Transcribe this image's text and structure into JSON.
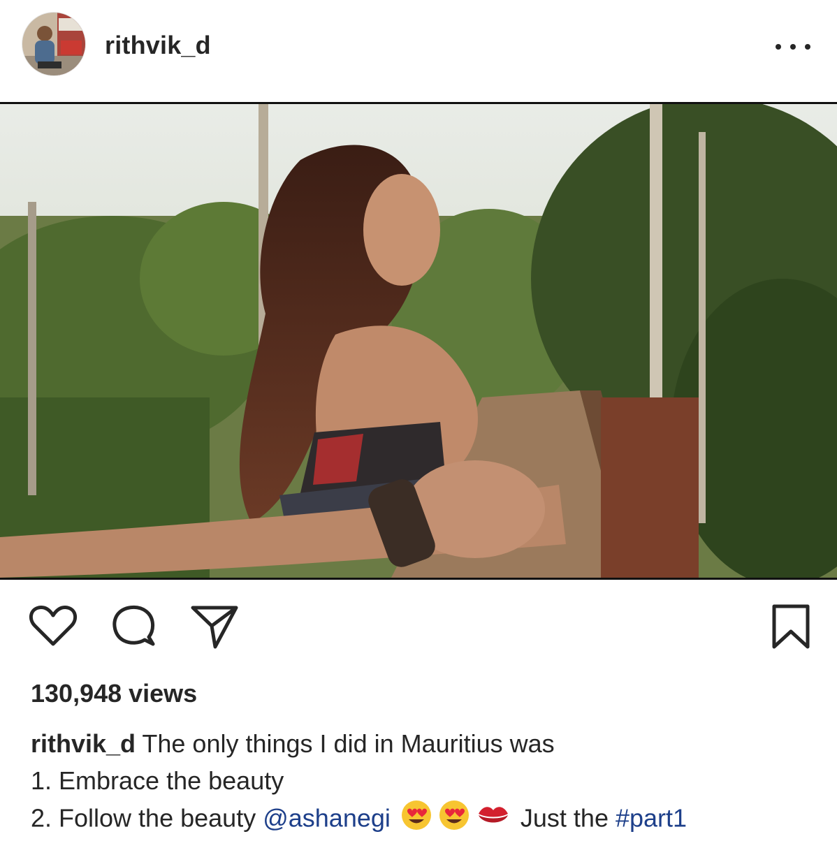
{
  "post": {
    "username": "rithvik_d",
    "more_icon": "more-horizontal-icon",
    "media_description_icon": "video-frame"
  },
  "actions": {
    "like_icon": "heart-icon",
    "comment_icon": "comment-bubble-icon",
    "share_icon": "paper-plane-icon",
    "save_icon": "bookmark-icon"
  },
  "stats": {
    "views": "130,948 views"
  },
  "caption": {
    "username": "rithvik_d",
    "line1_text": " The only things I did in Mauritius was",
    "line2": "1. Embrace the beauty",
    "line3_prefix": "2. Follow the beauty ",
    "mention": "@ashanegi",
    "emojis": [
      "heart-eyes-emoji",
      "heart-eyes-emoji",
      "kiss-mark-emoji"
    ],
    "line3_mid": " Just the ",
    "hashtag": "#part1"
  },
  "colors": {
    "text": "#262626",
    "link": "#1d3f8a",
    "background": "#ffffff"
  }
}
